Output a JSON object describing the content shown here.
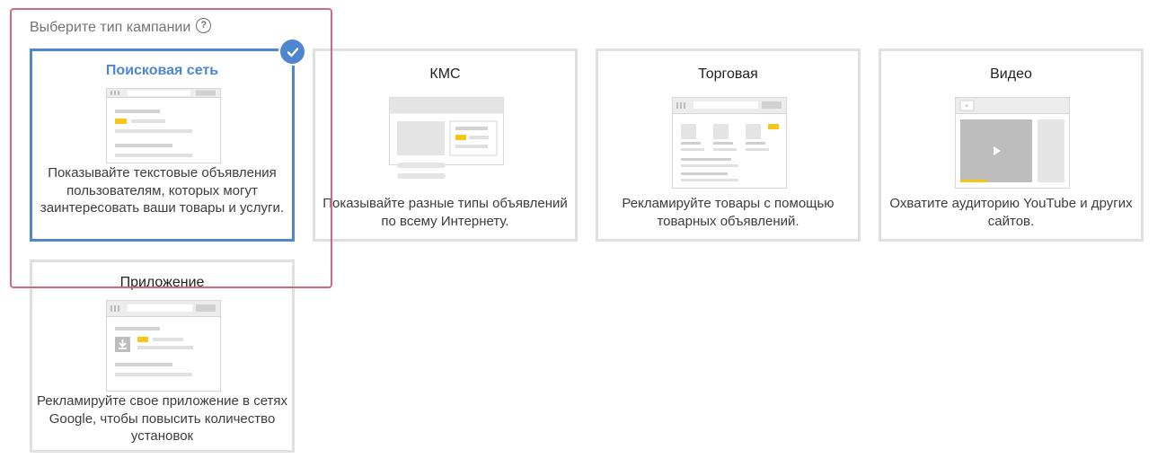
{
  "heading": {
    "label": "Выберите тип кампании",
    "help_icon": "question-circle-icon"
  },
  "campaign_types": [
    {
      "title": "Поисковая сеть",
      "description": "Показывайте текстовые объявления пользователям, которых могут заинтересовать ваши товары и услуги.",
      "selected": true
    },
    {
      "title": "КМС",
      "description": "Показывайте разные типы объявлений по всему Интернету.",
      "selected": false
    },
    {
      "title": "Торговая",
      "description": "Рекламируйте товары с помощью товарных объявлений.",
      "selected": false
    },
    {
      "title": "Видео",
      "description": "Охватите аудиторию YouTube и других сайтов.",
      "selected": false
    },
    {
      "title": "Приложение",
      "description": "Рекламируйте свое приложение в сетях Google, чтобы повысить количество установок",
      "selected": false
    }
  ],
  "colors": {
    "accent": "#4e86cf",
    "highlight": "#d26a7b",
    "ad_yellow": "#f5c518",
    "card_border": "#e0e0e0"
  }
}
